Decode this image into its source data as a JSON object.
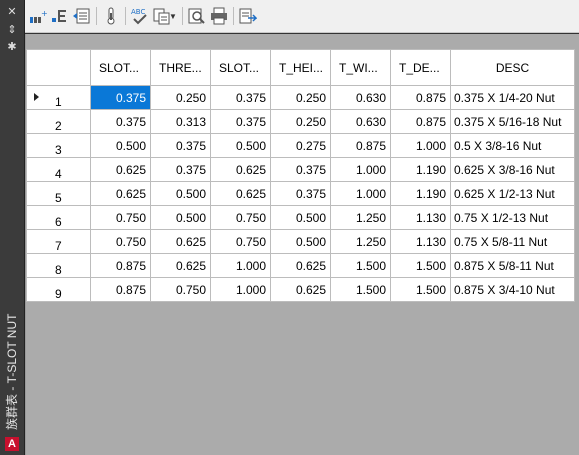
{
  "palette": {
    "title": "族群表 - T-SLOT NUT",
    "app_badge": "A"
  },
  "toolbar": {
    "icons": [
      "insert-row-icon",
      "insert-column-icon",
      "table-properties-icon",
      "thermometer-icon",
      "spell-check-icon",
      "paste-special-icon",
      "find-icon",
      "print-icon",
      "export-icon"
    ],
    "spell_label": "ABC"
  },
  "table": {
    "columns": [
      "SLOT...",
      "THRE...",
      "SLOT...",
      "T_HEI...",
      "T_WI...",
      "T_DE...",
      "DESC"
    ],
    "rows": [
      {
        "n": "1",
        "cells": [
          "0.375",
          "0.250",
          "0.375",
          "0.250",
          "0.630",
          "0.875",
          "0.375 X 1/4-20 Nut"
        ]
      },
      {
        "n": "2",
        "cells": [
          "0.375",
          "0.313",
          "0.375",
          "0.250",
          "0.630",
          "0.875",
          "0.375 X 5/16-18 Nut"
        ]
      },
      {
        "n": "3",
        "cells": [
          "0.500",
          "0.375",
          "0.500",
          "0.275",
          "0.875",
          "1.000",
          "0.5 X 3/8-16 Nut"
        ]
      },
      {
        "n": "4",
        "cells": [
          "0.625",
          "0.375",
          "0.625",
          "0.375",
          "1.000",
          "1.190",
          "0.625 X 3/8-16 Nut"
        ]
      },
      {
        "n": "5",
        "cells": [
          "0.625",
          "0.500",
          "0.625",
          "0.375",
          "1.000",
          "1.190",
          "0.625 X 1/2-13 Nut"
        ]
      },
      {
        "n": "6",
        "cells": [
          "0.750",
          "0.500",
          "0.750",
          "0.500",
          "1.250",
          "1.130",
          "0.75 X 1/2-13 Nut"
        ]
      },
      {
        "n": "7",
        "cells": [
          "0.750",
          "0.625",
          "0.750",
          "0.500",
          "1.250",
          "1.130",
          "0.75 X 5/8-11 Nut"
        ]
      },
      {
        "n": "8",
        "cells": [
          "0.875",
          "0.625",
          "1.000",
          "0.625",
          "1.500",
          "1.500",
          "0.875 X 5/8-11 Nut"
        ]
      },
      {
        "n": "9",
        "cells": [
          "0.875",
          "0.750",
          "1.000",
          "0.625",
          "1.500",
          "1.500",
          "0.875 X 3/4-10 Nut"
        ]
      }
    ],
    "selected": {
      "row": 0,
      "col": 0
    },
    "colors": {
      "selection": "#0a78d7",
      "empty_area": "#ababab"
    }
  }
}
